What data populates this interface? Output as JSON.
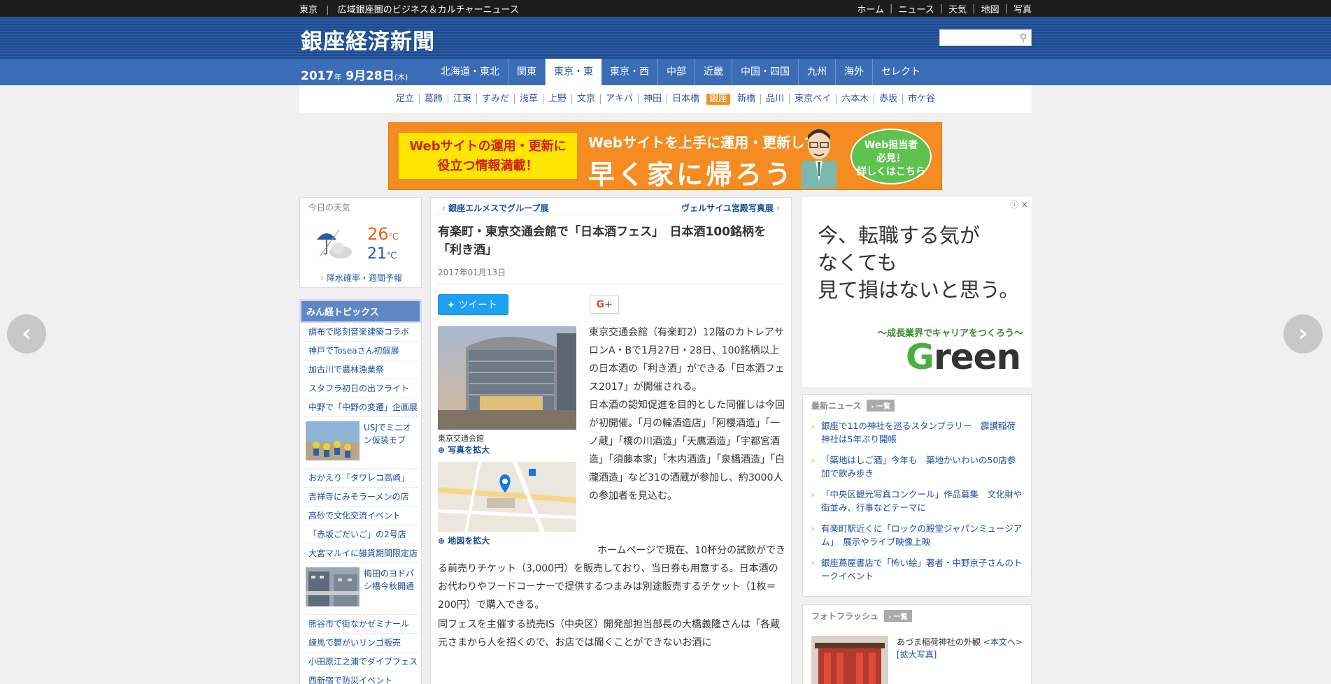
{
  "topbar": {
    "region": "東京",
    "tagline": "広域銀座圏のビジネス＆カルチャーニュース",
    "links": [
      "ホーム",
      "ニュース",
      "天気",
      "地図",
      "写真"
    ]
  },
  "header": {
    "logo": "銀座経済新聞",
    "search_placeholder": ""
  },
  "date": {
    "year": "2017",
    "year_unit": "年",
    "monthday": " 9月28日",
    "weekday": "(木)"
  },
  "regions": [
    "北海道・東北",
    "関東",
    "東京・東",
    "東京・西",
    "中部",
    "近畿",
    "中国・四国",
    "九州",
    "海外",
    "セレクト"
  ],
  "active_region": "東京・東",
  "subareas": [
    "足立",
    "葛飾",
    "江東",
    "すみだ",
    "浅草",
    "上野",
    "文京",
    "アキバ",
    "神田",
    "日本橋",
    "銀座",
    "新橋",
    "品川",
    "東京ベイ",
    "六本木",
    "赤坂",
    "市ケ谷"
  ],
  "active_subarea": "銀座",
  "banner": {
    "left_line1": "Webサイトの運用・更新に",
    "left_line2": "役立つ情報満載！",
    "mid_line1": "Webサイトを上手に運用・更新して",
    "mid_line2": "早く家に帰ろう",
    "bubble_line1": "Web担当者",
    "bubble_line2": "必見！",
    "bubble_line3": "詳しくはこちら"
  },
  "weather": {
    "title": "今日の天気",
    "high": "26",
    "low": "21",
    "unit": "℃",
    "forecast_link": "降水確率・週間予報"
  },
  "topics": {
    "title": "みん経トピックス",
    "items_a": [
      "調布で彫刻音楽建築コラボ",
      "神戸でToseaさん初個展",
      "加古川で農林漁業祭",
      "スタフラ初日の出フライト",
      "中野で「中野の変遷」企画展"
    ],
    "photo1_caption": "USJでミニオン仮装モブ",
    "items_b": [
      "おかえり「タワレコ高崎」",
      "吉祥寺にみそラーメンの店",
      "高砂で文化交流イベント",
      "「赤坂ごだいご」の2号店",
      "大宮マルイに雑貨期間限定店"
    ],
    "photo2_caption": "梅田のヨドバシ橋今秋開通",
    "items_c": [
      "熊谷市で街なかゼミナール",
      "練馬で鬱がいリンゴ販売",
      "小田原江之浦でダイブフェス",
      "西新宿で防災イベント"
    ]
  },
  "article": {
    "prev": "銀座エルメスでグループ展",
    "next": "ヴェルサイユ宮殿写真展",
    "title": "有楽町・東京交通会館で「日本酒フェス」　日本酒100銘柄を「利き酒」",
    "date": "2017年01月13日",
    "tweet": "ツイート",
    "gplus": "G+",
    "photo_caption": "東京交通会館",
    "photo_zoom": "写真を拡大",
    "map_zoom": "地図を拡大",
    "p1": "東京交通会館（有楽町2）12階のカトレアサロンA・Bで1月27日・28日、100銘柄以上の日本酒の「利き酒」ができる「日本酒フェス2017」が開催される。",
    "p2": "日本酒の認知促進を目的とした同催しは今回が初開催。「月の輪酒造店」「阿櫻酒造」「一ノ蔵」「橋の川酒造」「天鷹酒造」「宇都宮酒造」「須藤本家」「木内酒造」「泉橋酒造」「白瀧酒造」など31の酒蔵が参加し、約3000人の参加者を見込む。",
    "p3": "ホームページで現在、10杯分の試飲ができる前売りチケット（3,000円）を販売しており、当日券も用意する。日本酒のお代わりやフードコーナーで提供するつまみは別途販売するチケット（1枚＝200円）で購入できる。",
    "p4": "同フェスを主催する読売IS（中央区）開発部担当部長の大橋義隆さんは「各蔵元さまから人を招くので、お店では聞くことができないお酒に"
  },
  "ad_right": {
    "line1": "今、転職する気が",
    "line2": "なくても",
    "line3": "見て損はないと思う。",
    "tagline": "〜成長業界でキャリアをつくろう〜",
    "brand_g": "G",
    "brand_rest": "reen"
  },
  "news": {
    "title": "最新ニュース",
    "all": "一覧",
    "items": [
      "銀座で11の神社を巡るスタンプラリー　霹讃稲荷神社は5年ぶり開帳",
      "「築地はしご酒」今年も　築地かいわいの50店参加で飲み歩き",
      "「中央区観光写真コンクール」作品募集　文化財や街並み、行事などテーマに",
      "有楽町駅近くに「ロックの殿堂ジャパンミュージアム」　展示やライブ映像上映",
      "銀座蔦屋書店で「怖い絵」著者・中野京子さんのトークイベント"
    ]
  },
  "photo_flash": {
    "title": "フォトフラッシュ",
    "all": "一覧",
    "caption": "あづま稲荷神社の外観",
    "main_link": "<本文へ>",
    "zoom_link": "[拡大写真]"
  },
  "nav_arrows": {
    "prev": "‹",
    "next": "›"
  }
}
